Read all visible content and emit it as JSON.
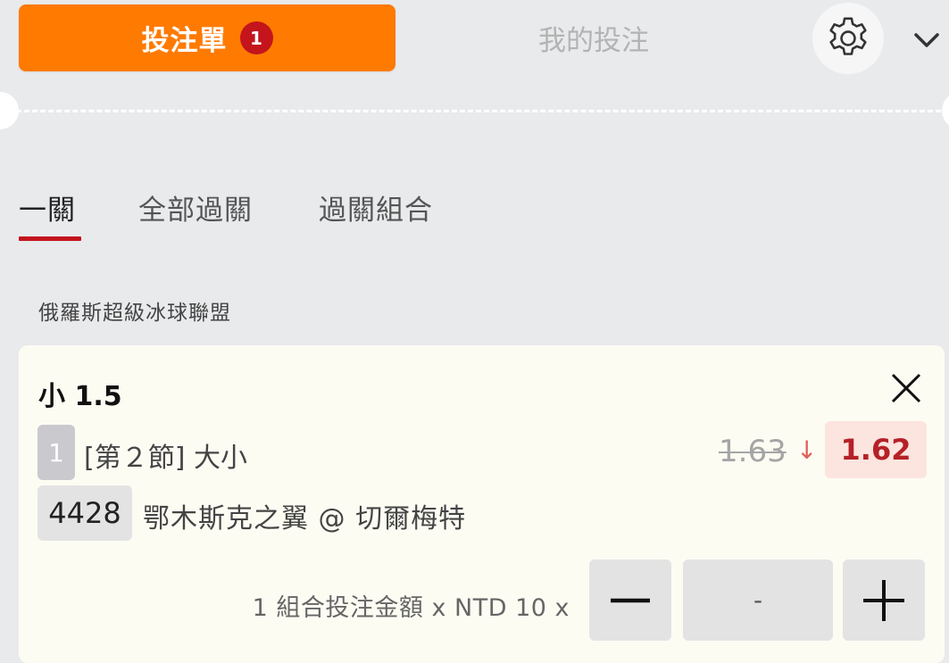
{
  "header": {
    "betslip_label": "投注單",
    "betslip_count": "1",
    "mybets_label": "我的投注"
  },
  "bet_type_tabs": [
    {
      "label": "一關",
      "active": true
    },
    {
      "label": "全部過關",
      "active": false
    },
    {
      "label": "過關組合",
      "active": false
    }
  ],
  "league": "俄羅斯超級冰球聯盟",
  "bet": {
    "selection": "小 1.5",
    "period_badge": "1",
    "market": "[第２節] 大小",
    "old_odds": "1.63",
    "odds_change_arrow": "↓",
    "new_odds": "1.62",
    "match_code": "4428",
    "match": "鄂木斯克之翼 @ 切爾梅特"
  },
  "stake": {
    "label": "1 組合投注金額 x NTD 10 x",
    "placeholder": "-"
  },
  "colors": {
    "accent": "#ff7a00",
    "badge_red": "#c4141c",
    "odds_down": "#b52127",
    "card_bg": "#fdfcf3",
    "page_bg": "#e9eaec"
  },
  "icons": [
    "gear-icon",
    "chevron-down-icon",
    "close-icon",
    "minus-icon",
    "plus-icon",
    "down-arrow-icon"
  ]
}
